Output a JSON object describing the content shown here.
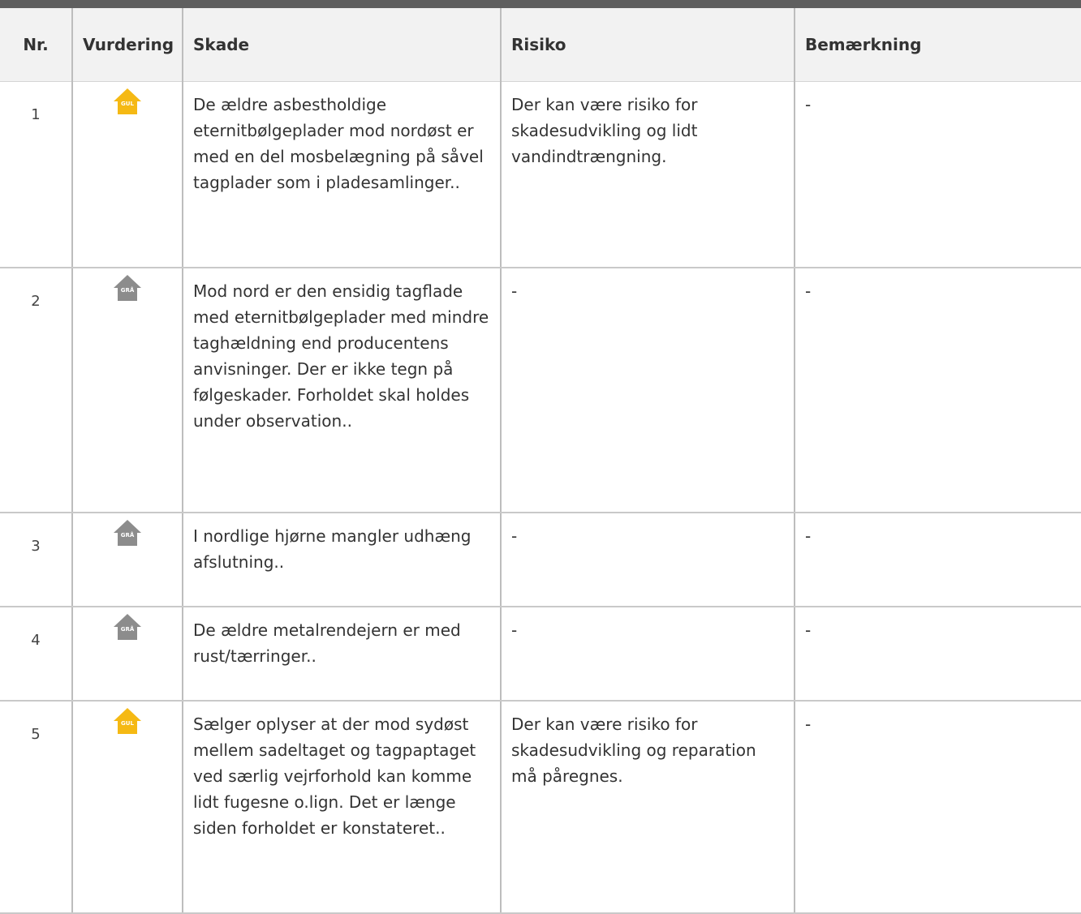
{
  "headers": {
    "nr": "Nr.",
    "vurdering": "Vurdering",
    "skade": "Skade",
    "risiko": "Risiko",
    "bemaerkning": "Bemærkning"
  },
  "rating_colors": {
    "GUL": "#f5b914",
    "GRÅ": "#8c8c8c"
  },
  "rows": [
    {
      "nr": "1",
      "rating": "GUL",
      "skade": "De ældre asbestholdige eternitbølgeplader mod nordøst er med en del mosbelægning på såvel tagplader som i pladesamlinger..",
      "risiko": "Der kan være risiko for skadesudvikling og lidt vandindtrængning.",
      "bemaerkning": "-"
    },
    {
      "nr": "2",
      "rating": "GRÅ",
      "skade": "Mod nord er den ensidig tagflade med eternitbølgeplader med mindre taghældning end producentens anvisninger. Der er ikke tegn på følgeskader. Forholdet skal holdes under observation..",
      "risiko": "-",
      "bemaerkning": "-"
    },
    {
      "nr": "3",
      "rating": "GRÅ",
      "skade": "I nordlige hjørne mangler udhæng afslutning..",
      "risiko": "-",
      "bemaerkning": "-"
    },
    {
      "nr": "4",
      "rating": "GRÅ",
      "skade": "De ældre metalrendejern er med rust/tærringer..",
      "risiko": "-",
      "bemaerkning": "-"
    },
    {
      "nr": "5",
      "rating": "GUL",
      "skade": "Sælger oplyser at der mod sydøst mellem sadeltaget og tagpaptaget ved særlig vejrforhold kan komme lidt fugesne o.lign. Det er længe siden forholdet er konstateret..",
      "risiko": "Der kan være risiko for skadesudvikling og reparation må påregnes.",
      "bemaerkning": "-"
    }
  ]
}
